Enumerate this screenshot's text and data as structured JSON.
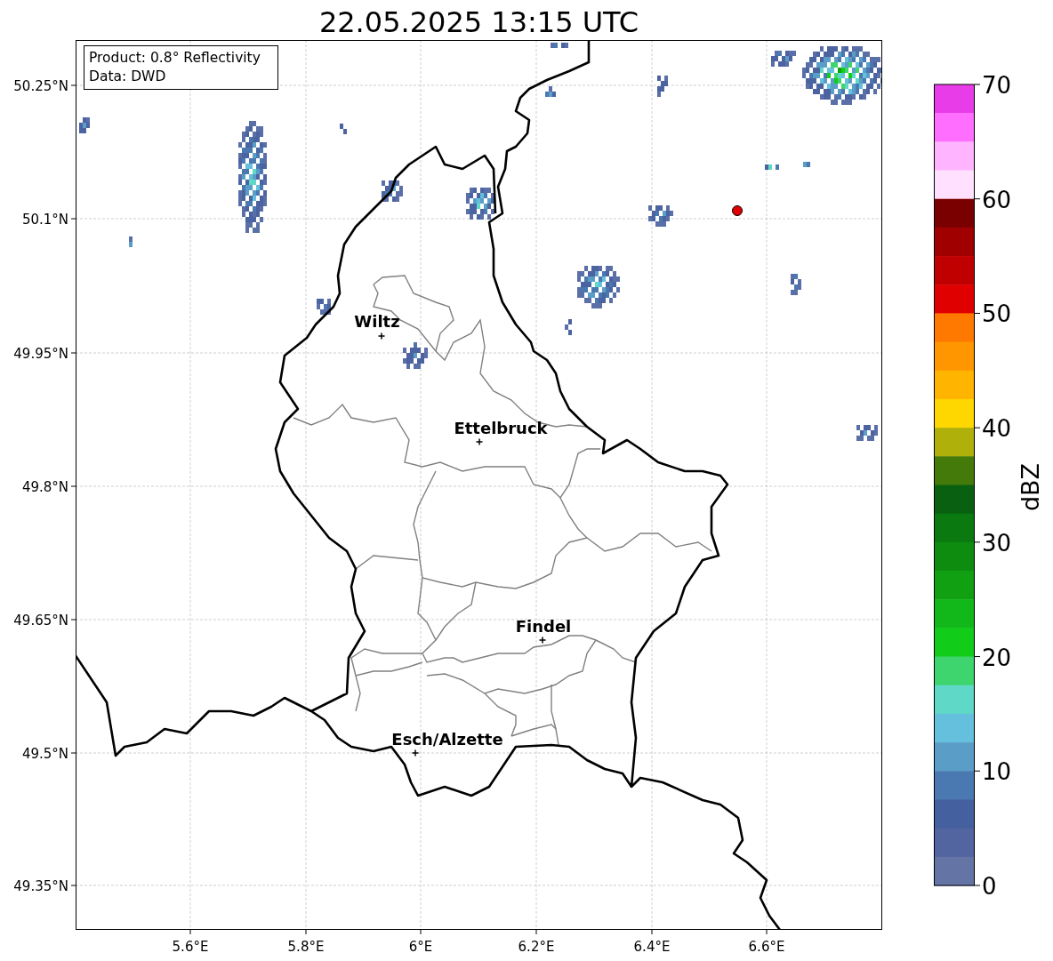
{
  "title": "22.05.2025 13:15 UTC",
  "info_box": [
    "Product: 0.8° Reflectivity",
    "Data: DWD"
  ],
  "map": {
    "x_ticks": [
      "5.6°E",
      "5.8°E",
      "6°E",
      "6.2°E",
      "6.4°E",
      "6.6°E"
    ],
    "y_ticks": [
      "50.25°N",
      "50.1°N",
      "49.95°N",
      "49.8°N",
      "49.65°N",
      "49.5°N",
      "49.35°N"
    ],
    "places": [
      {
        "name": "Wiltz"
      },
      {
        "name": "Ettelbruck"
      },
      {
        "name": "Findel"
      },
      {
        "name": "Esch/Alzette"
      }
    ]
  },
  "colorbar": {
    "label": "dBZ",
    "ticks": [
      "70",
      "60",
      "50",
      "40",
      "30",
      "20",
      "10",
      "0"
    ],
    "segments": [
      {
        "color": "#e83ce8"
      },
      {
        "color": "#ff6eff"
      },
      {
        "color": "#ffb4ff"
      },
      {
        "color": "#ffe0ff"
      },
      {
        "color": "#7a0000"
      },
      {
        "color": "#a00000"
      },
      {
        "color": "#c00000"
      },
      {
        "color": "#e00000"
      },
      {
        "color": "#ff7800"
      },
      {
        "color": "#ff9600"
      },
      {
        "color": "#ffb400"
      },
      {
        "color": "#ffd700"
      },
      {
        "color": "#b0b00a"
      },
      {
        "color": "#447a0a"
      },
      {
        "color": "#086010"
      },
      {
        "color": "#0a7a10"
      },
      {
        "color": "#0e8c10"
      },
      {
        "color": "#10a012"
      },
      {
        "color": "#12b81a"
      },
      {
        "color": "#12cc1a"
      },
      {
        "color": "#3ed56e"
      },
      {
        "color": "#60d8c8"
      },
      {
        "color": "#64c0dc"
      },
      {
        "color": "#5a9ec8"
      },
      {
        "color": "#4a78b0"
      },
      {
        "color": "#44609e"
      },
      {
        "color": "#5265a0"
      },
      {
        "color": "#6474a5"
      }
    ]
  }
}
